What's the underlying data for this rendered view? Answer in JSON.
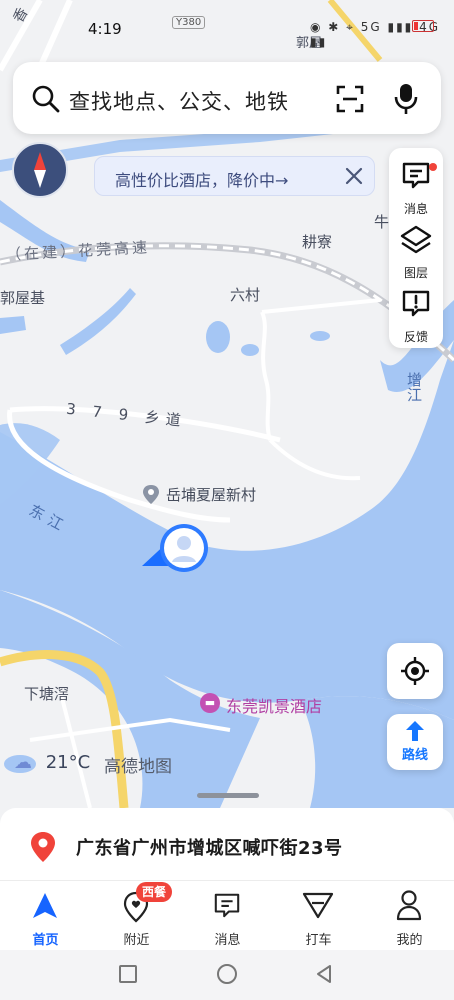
{
  "status_bar": {
    "time": "4:19",
    "indicators": "◉ ✱ ⌖ 5G ▮▮▮ 4G ▮▮"
  },
  "search": {
    "placeholder": "查找地点、公交、地铁"
  },
  "promo_banner": {
    "text": "高性价比酒店，降价中→"
  },
  "toolbar": {
    "messages_label": "消息",
    "layers_label": "图层",
    "feedback_label": "反馈"
  },
  "route_button": {
    "label": "路线"
  },
  "map_labels": {
    "road_highway": "（在建）花莞高速",
    "road_local": "3 7 9 乡道",
    "village_geng": "耕寮",
    "village_liu": "六村",
    "village_guowu": "郭屋基",
    "place_poi": "岳埔夏屋新村",
    "river_dongjiang": "东江",
    "river_zengjiang": "增江",
    "village_xiatang": "下塘滘",
    "hotel": "东莞凯景酒店",
    "top_guowu": "郭屋",
    "road_top": "Y380",
    "top_left_edge": "香",
    "right_edge": "牛"
  },
  "weather": {
    "temperature": "21°C",
    "brand": "高德地图"
  },
  "location_sheet": {
    "address": "广东省广州市增城区喊吓街23号"
  },
  "tabs": [
    {
      "label": "首页",
      "icon": "navigation-arrow-icon",
      "active": true
    },
    {
      "label": "附近",
      "icon": "location-heart-icon",
      "active": false
    },
    {
      "label": "消息",
      "icon": "chat-bubble-icon",
      "active": false
    },
    {
      "label": "打车",
      "icon": "taxi-flag-icon",
      "active": false
    },
    {
      "label": "我的",
      "icon": "user-icon",
      "active": false
    }
  ],
  "nearby_badge": "西餐",
  "colors": {
    "accent": "#1664ff",
    "water": "#a5c6f4",
    "land": "#f1f2f4",
    "road": "#ffffff",
    "highway": "#f5d56a",
    "badge": "#f0433a"
  }
}
